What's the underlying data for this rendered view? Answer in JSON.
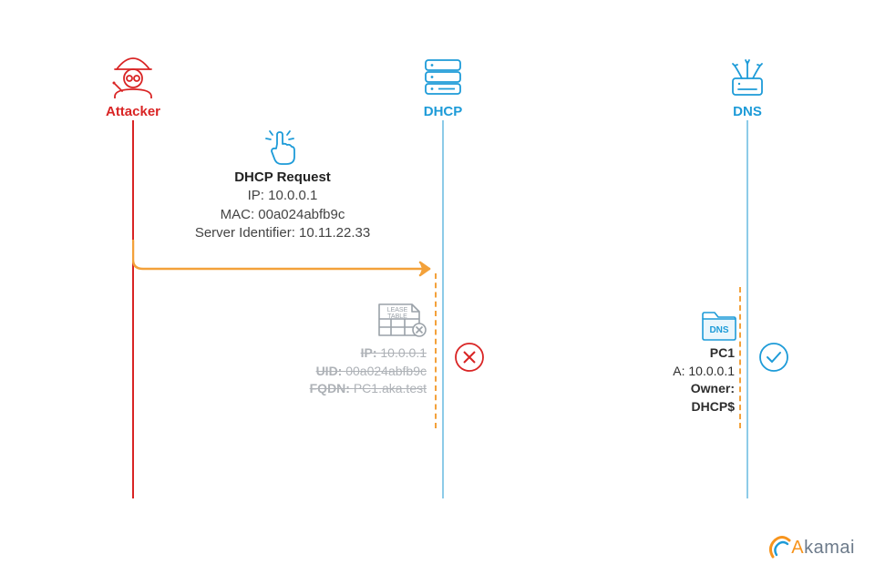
{
  "actors": {
    "attacker": "Attacker",
    "dhcp": "DHCP",
    "dns": "DNS"
  },
  "request": {
    "title": "DHCP Request",
    "ip": "IP: 10.0.0.1",
    "mac": "MAC: 00a024abfb9c",
    "server_id": "Server Identifier: 10.11.22.33"
  },
  "lease_table": {
    "label1": "LEASE",
    "label2": "TABLE",
    "ip_k": "IP: ",
    "ip_v": "10.0.0.1",
    "uid_k": "UID: ",
    "uid_v": "00a024abfb9c",
    "fqdn_k": "FQDN: ",
    "fqdn_v": "PC1.aka.test"
  },
  "dns_record": {
    "tag": "DNS",
    "name_k": "PC1",
    "a": "A: 10.0.0.1",
    "owner": "Owner: DHCP$"
  },
  "brand": "Akamai"
}
